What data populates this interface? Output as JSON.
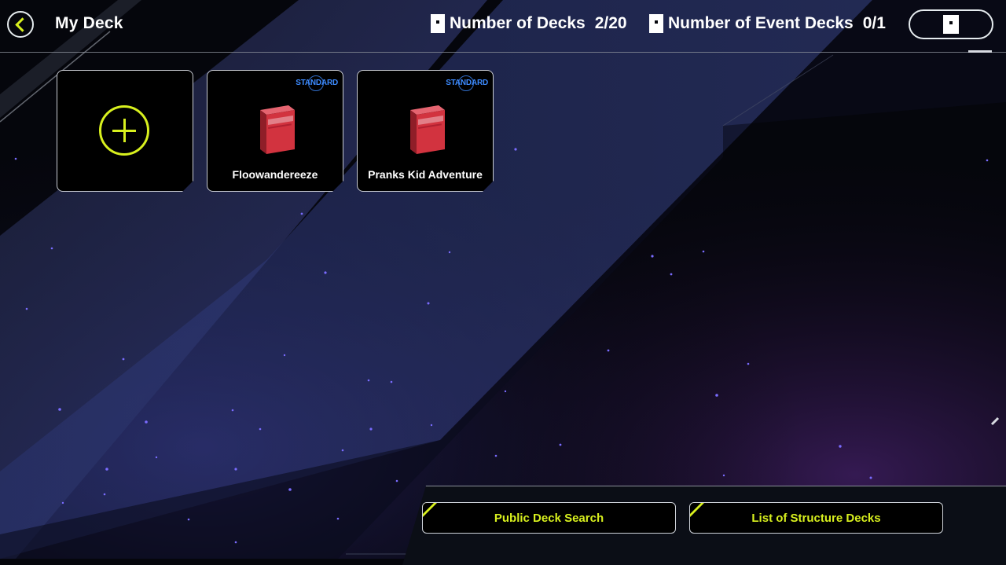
{
  "header": {
    "title": "My Deck",
    "back_icon": "back-arrow-icon",
    "decks_label": "Number of Decks",
    "decks_value": "2/20",
    "event_decks_label": "Number of Event Decks",
    "event_decks_value": "0/1",
    "menu_icon": "card-icon"
  },
  "decks": [
    {
      "type": "create",
      "icon": "plus-icon"
    },
    {
      "name": "Floowandereeze",
      "badge": "STANDARD",
      "icon": "deck-box-icon"
    },
    {
      "name": "Pranks Kid Adventure",
      "badge": "STANDARD",
      "icon": "deck-box-icon"
    }
  ],
  "buttons": {
    "public_search": "Public Deck Search",
    "structure_list": "List of Structure Decks"
  },
  "colors": {
    "accent": "#d8f01e",
    "badge": "#3d8bff",
    "deck_box": "#d2333f",
    "background": "#05060c"
  }
}
